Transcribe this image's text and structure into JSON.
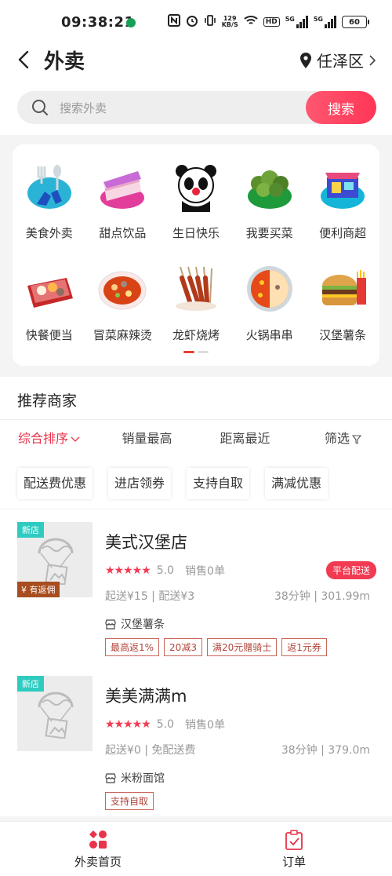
{
  "status": {
    "time": "09:38:21",
    "speed_value": "129",
    "speed_unit": "KB/S",
    "hd": "HD",
    "net1": "5G",
    "net2": "5G",
    "battery": "60"
  },
  "header": {
    "title": "外卖",
    "location": "任泽区"
  },
  "search": {
    "placeholder": "搜索外卖",
    "button": "搜索"
  },
  "categories": [
    {
      "label": "美食外卖",
      "icon": "food-delivery-icon"
    },
    {
      "label": "甜点饮品",
      "icon": "cake-icon"
    },
    {
      "label": "生日快乐",
      "icon": "panda-icon"
    },
    {
      "label": "我要买菜",
      "icon": "vegetable-icon"
    },
    {
      "label": "便利商超",
      "icon": "store-icon"
    },
    {
      "label": "快餐便当",
      "icon": "bento-icon"
    },
    {
      "label": "冒菜麻辣烫",
      "icon": "spicy-pot-icon"
    },
    {
      "label": "龙虾烧烤",
      "icon": "bbq-icon"
    },
    {
      "label": "火锅串串",
      "icon": "hotpot-icon"
    },
    {
      "label": "汉堡薯条",
      "icon": "burger-icon"
    }
  ],
  "recommend": {
    "title": "推荐商家",
    "sort": [
      "综合排序",
      "销量最高",
      "距离最近",
      "筛选"
    ],
    "filters": [
      "配送费优惠",
      "进店领券",
      "支持自取",
      "满减优惠"
    ],
    "shops": [
      {
        "new_tag": "新店",
        "rebate": "¥ 有返佣",
        "name": "美式汉堡店",
        "stars": "★★★★★",
        "rating": "5.0",
        "sales": "销售0单",
        "badge": "平台配送",
        "fee": "起送¥15 | 配送¥3",
        "distance": "38分钟 | 301.99m",
        "category": "汉堡薯条",
        "tags": [
          "最高返1%",
          "20减3",
          "满20元赠骑士",
          "返1元券"
        ]
      },
      {
        "new_tag": "新店",
        "name": "美美满满m",
        "stars": "★★★★★",
        "rating": "5.0",
        "sales": "销售0单",
        "fee": "起送¥0 | 免配送费",
        "distance": "38分钟 | 379.0m",
        "category": "米粉面馆",
        "tags": [
          "支持自取"
        ]
      }
    ]
  },
  "nav": [
    {
      "label": "外卖首页",
      "icon": "home-grid-icon",
      "color": "#e8334a"
    },
    {
      "label": "订单",
      "icon": "order-clipboard-icon",
      "color": "#e8334a"
    }
  ]
}
